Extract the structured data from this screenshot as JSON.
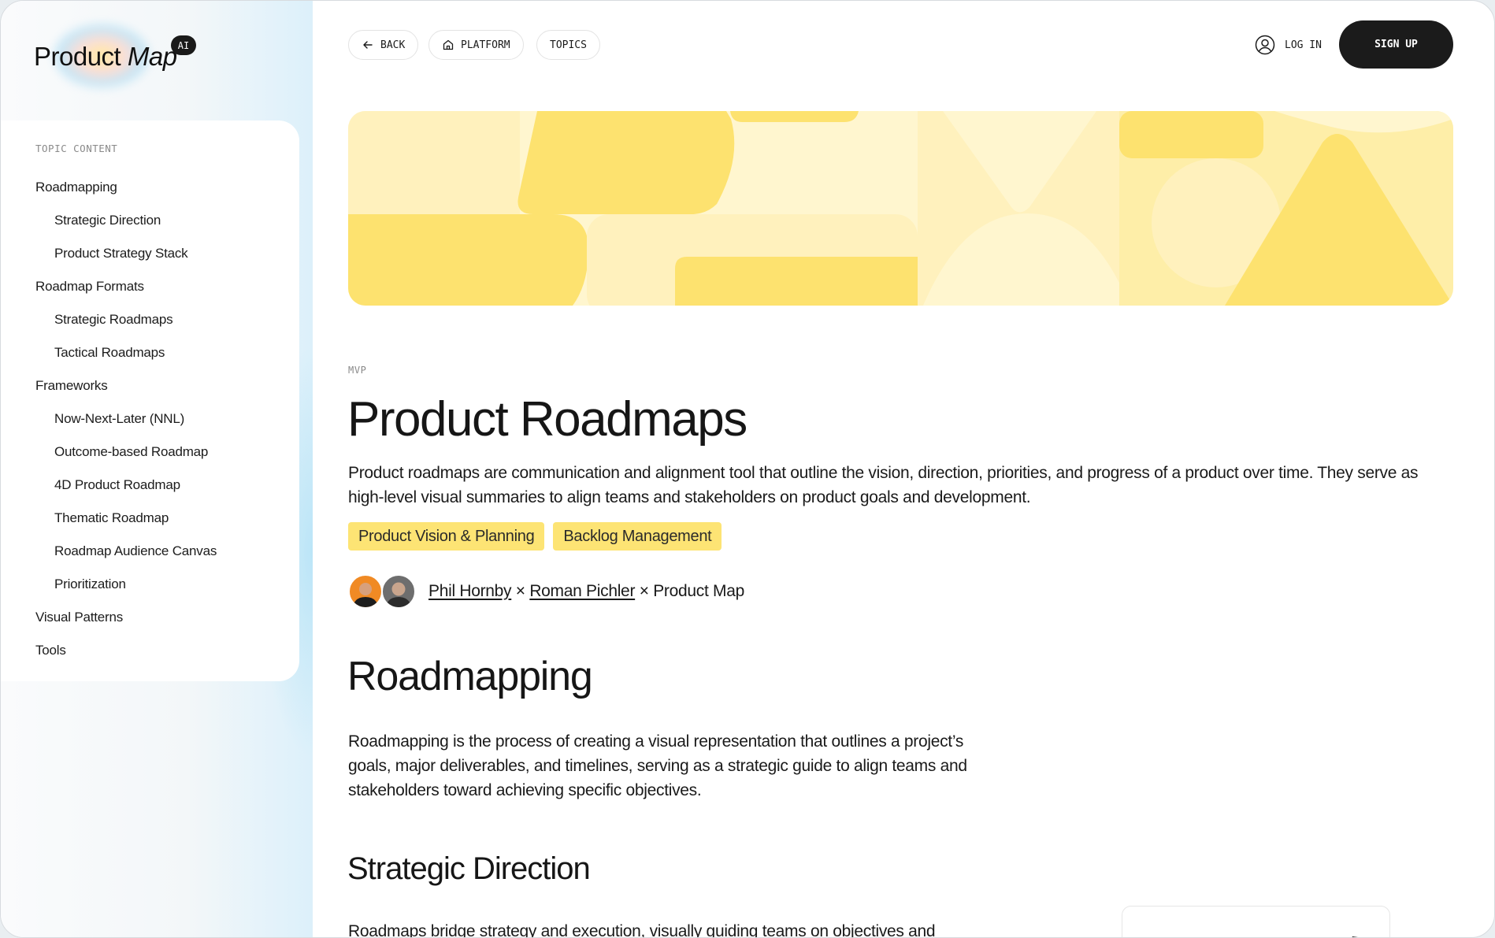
{
  "brand": {
    "name_regular": "Product",
    "name_italic": "Map",
    "badge": "AI"
  },
  "toc": {
    "heading": "TOPIC CONTENT",
    "items": [
      {
        "label": "Roadmapping",
        "level": 1
      },
      {
        "label": "Strategic Direction",
        "level": 2
      },
      {
        "label": "Product Strategy Stack",
        "level": 2
      },
      {
        "label": "Roadmap Formats",
        "level": 1
      },
      {
        "label": "Strategic Roadmaps",
        "level": 2
      },
      {
        "label": "Tactical Roadmaps",
        "level": 2
      },
      {
        "label": "Frameworks",
        "level": 1
      },
      {
        "label": "Now-Next-Later (NNL)",
        "level": 2
      },
      {
        "label": "Outcome-based Roadmap",
        "level": 2
      },
      {
        "label": "4D Product Roadmap",
        "level": 2
      },
      {
        "label": "Thematic Roadmap",
        "level": 2
      },
      {
        "label": "Roadmap Audience Canvas",
        "level": 2
      },
      {
        "label": "Prioritization",
        "level": 2
      },
      {
        "label": "Visual Patterns",
        "level": 1
      },
      {
        "label": "Tools",
        "level": 1
      }
    ]
  },
  "nav": {
    "back": {
      "label": "BACK",
      "icon": "arrow-left-icon"
    },
    "platform": {
      "label": "PLATFORM",
      "icon": "home-icon"
    },
    "topics": {
      "label": "TOPICS"
    },
    "login": {
      "label": "LOG IN",
      "icon": "user-circle-icon"
    },
    "signup": {
      "label": "SIGN UP"
    }
  },
  "colors": {
    "accent_yellow": "#fde474",
    "hero_dark_yellow": "#fde26f",
    "hero_mid_yellow": "#feeea8",
    "hero_light_yellow": "#fff6cf",
    "button_dark": "#1b1b1b"
  },
  "article": {
    "eyebrow": "MVP",
    "title": "Product Roadmaps",
    "lead": "Product roadmaps are communication and alignment tool that outline the vision, direction, priorities, and progress of a product over time. They serve as high-level visual summaries to align teams and stakeholders on product goals and development.",
    "tags": [
      "Product Vision & Planning",
      "Backlog Management"
    ],
    "authors": {
      "author1": "Phil Hornby",
      "separator": "×",
      "author2": "Roman Pichler",
      "publisher": "Product Map"
    },
    "section1": {
      "heading": "Roadmapping",
      "body": "Roadmapping is the process of creating a visual representation that outlines a project’s goals, major deliverables, and timelines, serving as a strategic guide to align teams and stakeholders toward achieving specific objectives."
    },
    "section2": {
      "heading": "Strategic Direction",
      "body": "Roadmaps bridge strategy and execution, visually guiding teams on objectives and"
    }
  }
}
